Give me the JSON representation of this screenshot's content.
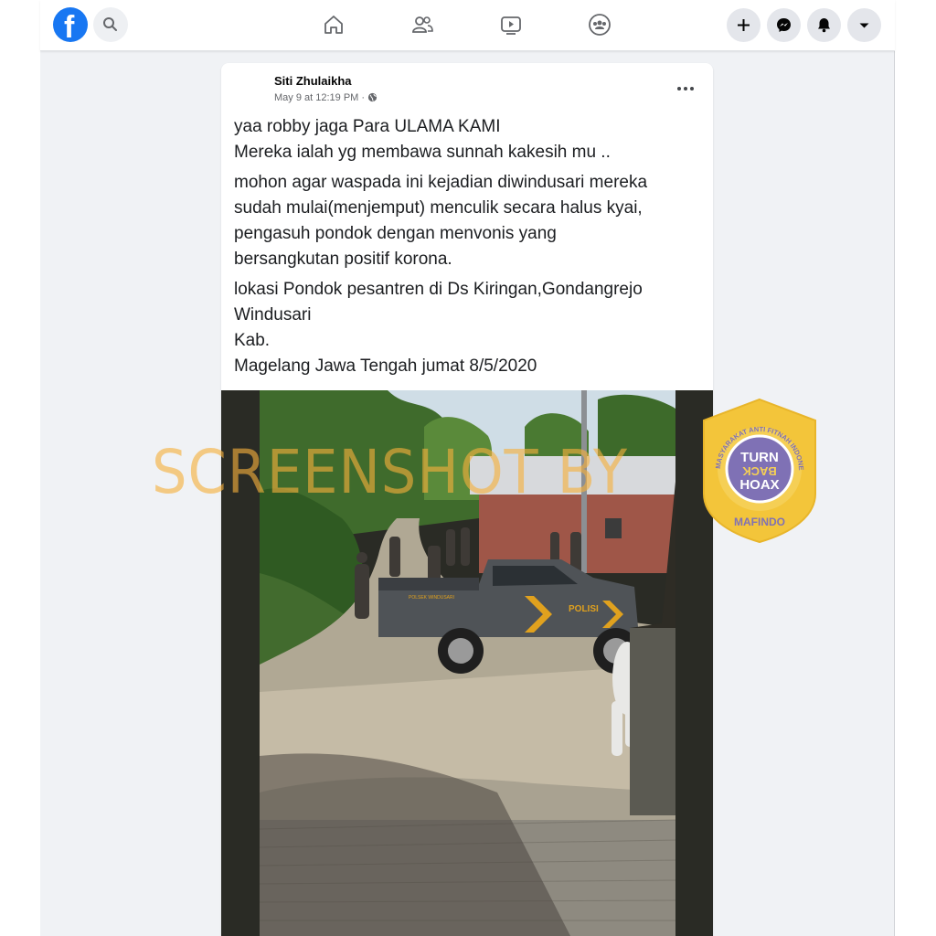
{
  "topbar": {
    "logo_letter": "f",
    "icons": [
      "facebook-logo-icon",
      "search-icon",
      "home-icon",
      "friends-icon",
      "watch-icon",
      "groups-icon",
      "plus-icon",
      "messenger-icon",
      "bell-icon",
      "caret-down-icon"
    ]
  },
  "post": {
    "author": "Siti Zhulaikha",
    "meta": "May 9 at 12:19 PM ·",
    "more": "•••",
    "paragraphs": [
      [
        "yaa robby jaga Para ULAMA KAMI",
        "Mereka ialah yg membawa sunnah kakesih mu .."
      ],
      [
        "mohon agar waspada ini kejadian diwindusari mereka",
        "sudah mulai(menjemput) menculik secara halus kyai,",
        "pengasuh pondok dengan menvonis yang",
        "bersangkutan positif korona."
      ],
      [
        "lokasi Pondok pesantren di Ds Kiringan,Gondangrejo",
        "Windusari",
        "Kab.",
        "Magelang Jawa Tengah jumat 8/5/2020"
      ]
    ]
  },
  "photo": {
    "truck_door_text": "POLISI",
    "truck_bed_text": "POLSEK WINDUSARI"
  },
  "watermark": "SCREENSHOT BY",
  "badge": {
    "arc_text": "MASYARAKAT ANTI FITNAH INDONESIA",
    "line1": "TURN",
    "line2": "BACK",
    "line3": "HOAX",
    "bottom": "MAFINDO"
  },
  "colors": {
    "facebook_blue": "#1877f2",
    "page_bg": "#f0f2f5",
    "watermark": "#f5b03c",
    "badge_gold": "#f3c53a",
    "badge_purple": "#7f71b5"
  }
}
